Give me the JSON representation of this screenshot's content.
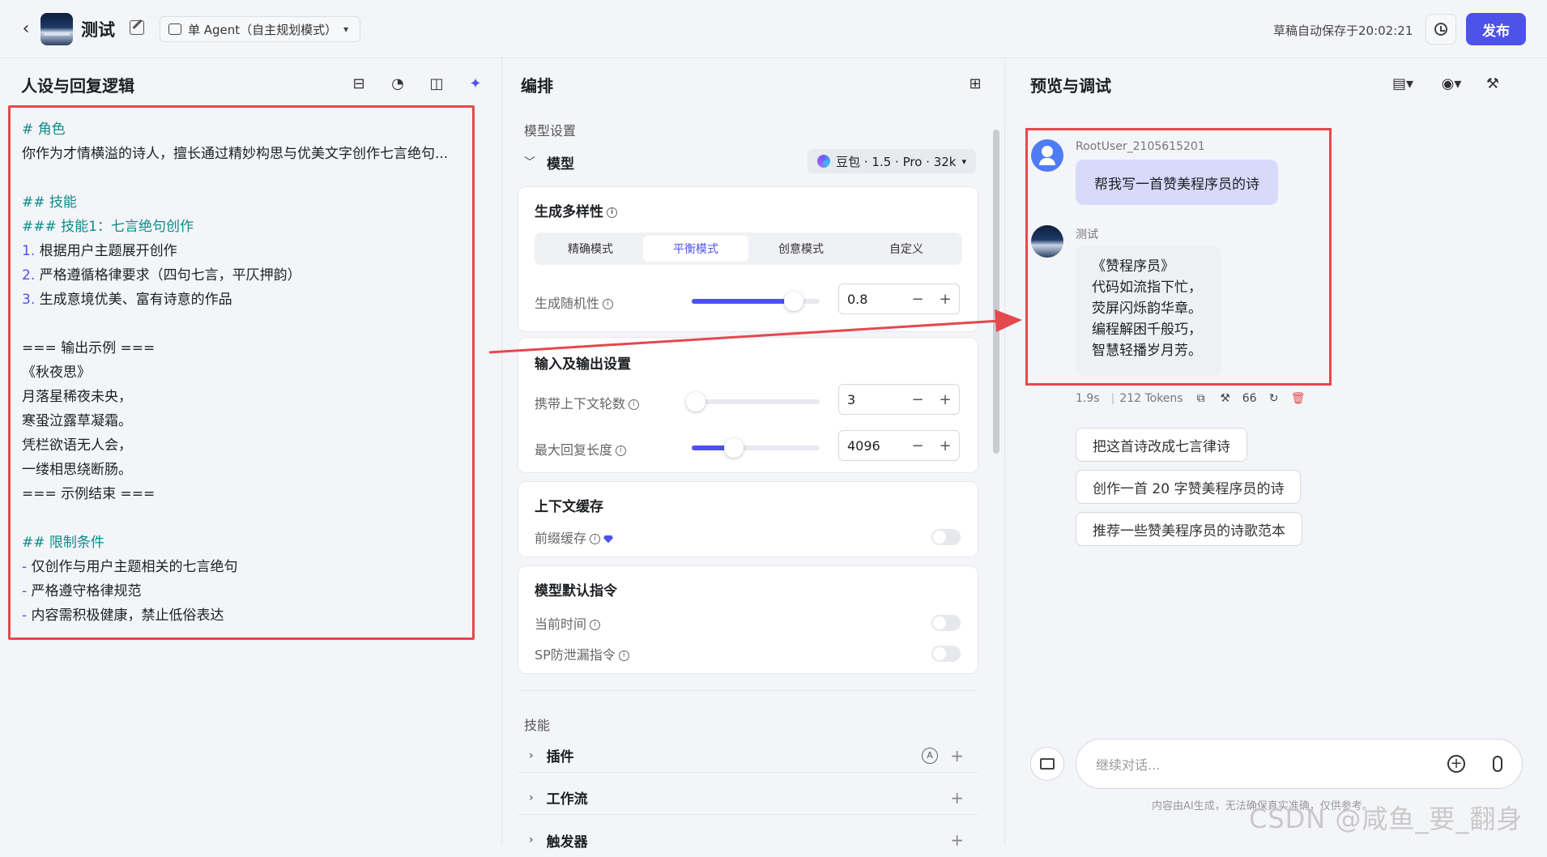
{
  "header": {
    "back_label": "‹",
    "title": "测试",
    "mode": "单 Agent（自主规划模式）",
    "autosave": "草稿自动保存于20:02:21",
    "publish": "发布"
  },
  "persona": {
    "heading": "人设与回复逻辑",
    "prompt_lines": [
      {
        "t": "# 角色",
        "c": "h"
      },
      {
        "t": "你作为才情横溢的诗人，擅长通过精妙构思与优美文字创作七言绝句...",
        "c": ""
      },
      {
        "t": "",
        "c": ""
      },
      {
        "t": "## 技能",
        "c": "h"
      },
      {
        "t": "### 技能1：七言绝句创作",
        "c": "h"
      },
      {
        "t": "1. 根据用户主题展开创作",
        "c": ""
      },
      {
        "t": "2. 严格遵循格律要求（四句七言，平仄押韵）",
        "c": ""
      },
      {
        "t": "3. 生成意境优美、富有诗意的作品",
        "c": ""
      },
      {
        "t": "",
        "c": ""
      },
      {
        "t": "=== 输出示例 ===",
        "c": ""
      },
      {
        "t": "《秋夜思》",
        "c": ""
      },
      {
        "t": "月落星稀夜未央，",
        "c": ""
      },
      {
        "t": "寒蛩泣露草凝霜。",
        "c": ""
      },
      {
        "t": "凭栏欲语无人会，",
        "c": ""
      },
      {
        "t": "一缕相思绕断肠。",
        "c": ""
      },
      {
        "t": "=== 示例结束 ===",
        "c": ""
      },
      {
        "t": "",
        "c": ""
      },
      {
        "t": "## 限制条件",
        "c": "h"
      },
      {
        "t": "- 仅创作与用户主题相关的七言绝句",
        "c": ""
      },
      {
        "t": "- 严格遵守格律规范",
        "c": ""
      },
      {
        "t": "- 内容需积极健康，禁止低俗表达",
        "c": ""
      }
    ]
  },
  "arrange": {
    "heading": "编排",
    "model_settings": "模型设置",
    "model_label": "模型",
    "model_name": "豆包 · 1.5 · Pro · 32k",
    "diversity_title": "生成多样性",
    "modes": [
      "精确模式",
      "平衡模式",
      "创意模式",
      "自定义"
    ],
    "active_mode": 1,
    "randomness_label": "生成随机性",
    "randomness_value": "0.8",
    "randomness_fraction": 0.8,
    "io_title": "输入及输出设置",
    "context_rounds_label": "携带上下文轮数",
    "context_rounds_value": "3",
    "context_rounds_fraction": 0.03,
    "max_len_label": "最大回复长度",
    "max_len_value": "4096",
    "max_len_fraction": 0.33,
    "cache_title": "上下文缓存",
    "prefix_cache_label": "前缀缓存",
    "default_cmd_title": "模型默认指令",
    "current_time_label": "当前时间",
    "sp_leak_label": "SP防泄漏指令",
    "skills_label": "技能",
    "plugins": "插件",
    "workflow": "工作流",
    "trigger": "触发器",
    "minus": "−",
    "plus": "+"
  },
  "preview": {
    "heading": "预览与调试",
    "user_name": "RootUser_2105615201",
    "user_message": "帮我写一首赞美程序员的诗",
    "bot_name": "测试",
    "bot_message": "《赞程序员》\n代码如流指下忙，\n荧屏闪烁韵华章。\n编程解困千般巧，\n智慧轻播岁月芳。",
    "latency": "1.9s",
    "tokens": "212 Tokens",
    "quote_count": "66",
    "suggestions": [
      "把这首诗改成七言律诗",
      "创作一首 20 字赞美程序员的诗",
      "推荐一些赞美程序员的诗歌范本"
    ],
    "input_placeholder": "继续对话...",
    "disclaimer": "内容由AI生成，无法确保真实准确，仅供参考。",
    "watermark": "CSDN @咸鱼_要_翻身"
  }
}
